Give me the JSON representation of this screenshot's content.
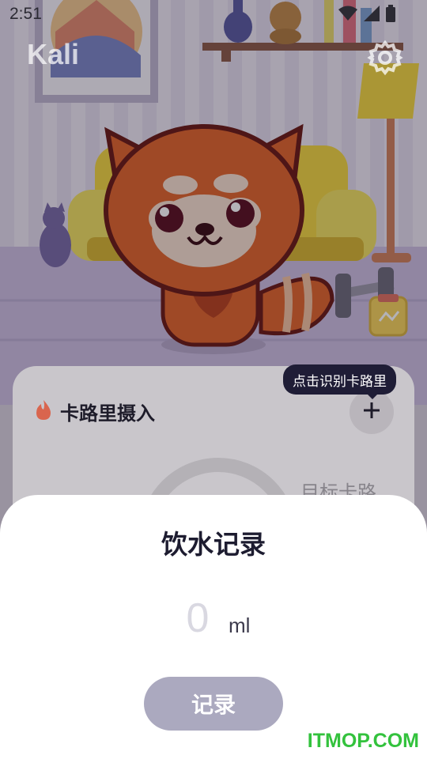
{
  "status_bar": {
    "time": "2:51"
  },
  "app": {
    "title": "Kali"
  },
  "icons": {
    "settings": "gear-icon",
    "flame": "flame-icon",
    "add": "plus-icon",
    "wifi": "wifi-icon",
    "signal": "signal-icon",
    "battery": "battery-icon"
  },
  "calorie_card": {
    "title": "卡路里摄入",
    "tooltip": "点击识别卡路里",
    "target_label": "目标卡路"
  },
  "water_sheet": {
    "title": "饮水记录",
    "amount": "0",
    "unit": "ml",
    "record_label": "记录"
  },
  "watermark": "ITMOP.COM",
  "colors": {
    "accent": "#aba9bf",
    "tooltip_bg": "#1f1d36",
    "title_text": "#1d1c30",
    "watermark": "#33c23d"
  }
}
